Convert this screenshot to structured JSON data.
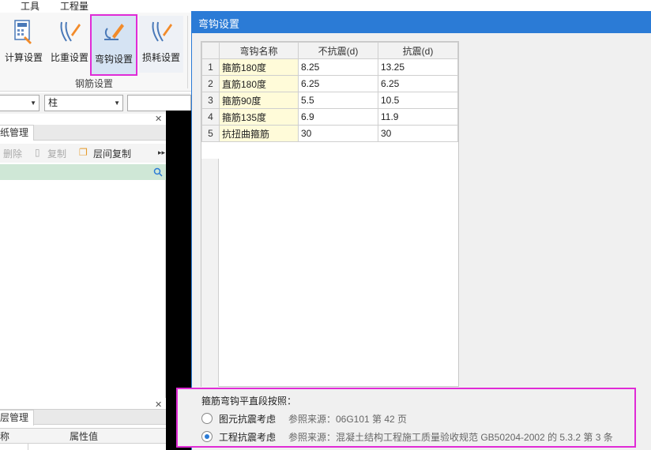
{
  "menubar": {
    "items": [
      "工具",
      "工程量"
    ]
  },
  "ribbon": {
    "buttons": [
      {
        "label": "计算设置",
        "icon": "calc-settings-icon"
      },
      {
        "label": "比重设置",
        "icon": "weight-settings-icon"
      },
      {
        "label": "弯钩设置",
        "icon": "hook-settings-icon"
      },
      {
        "label": "损耗设置",
        "icon": "loss-settings-icon"
      }
    ],
    "group_label": "钢筋设置"
  },
  "combos": {
    "first": "",
    "second": "柱"
  },
  "drawing_panel": {
    "title": "纸管理",
    "toolbar": {
      "delete": "删除",
      "copy": "复制",
      "floor_copy": "层间复制"
    }
  },
  "attr_panel": {
    "title": "层管理",
    "col_name": "称",
    "col_value": "属性值"
  },
  "dialog": {
    "title": "弯钩设置",
    "table": {
      "headers": [
        "弯钩名称",
        "不抗震(d)",
        "抗震(d)"
      ],
      "rows": [
        {
          "n": "1",
          "name": "箍筋180度",
          "non_seismic": "8.25",
          "seismic": "13.25"
        },
        {
          "n": "2",
          "name": "直筋180度",
          "non_seismic": "6.25",
          "seismic": "6.25"
        },
        {
          "n": "3",
          "name": "箍筋90度",
          "non_seismic": "5.5",
          "seismic": "10.5"
        },
        {
          "n": "4",
          "name": "箍筋135度",
          "non_seismic": "6.9",
          "seismic": "11.9"
        },
        {
          "n": "5",
          "name": "抗扭曲箍筋",
          "non_seismic": "30",
          "seismic": "30"
        }
      ]
    },
    "group": {
      "title": "箍筋弯钩平直段按照：",
      "options": [
        {
          "label": "图元抗震考虑",
          "ref": "参照来源：06G101 第 42 页",
          "checked": false
        },
        {
          "label": "工程抗震考虑",
          "ref": "参照来源：混凝土结构工程施工质量验收规范 GB50204-2002 的 5.3.2 第 3 条",
          "checked": true
        }
      ]
    }
  },
  "colors": {
    "accent": "#2b7bd6",
    "highlight": "#e02bd6",
    "name_cell": "#fffbd9"
  }
}
